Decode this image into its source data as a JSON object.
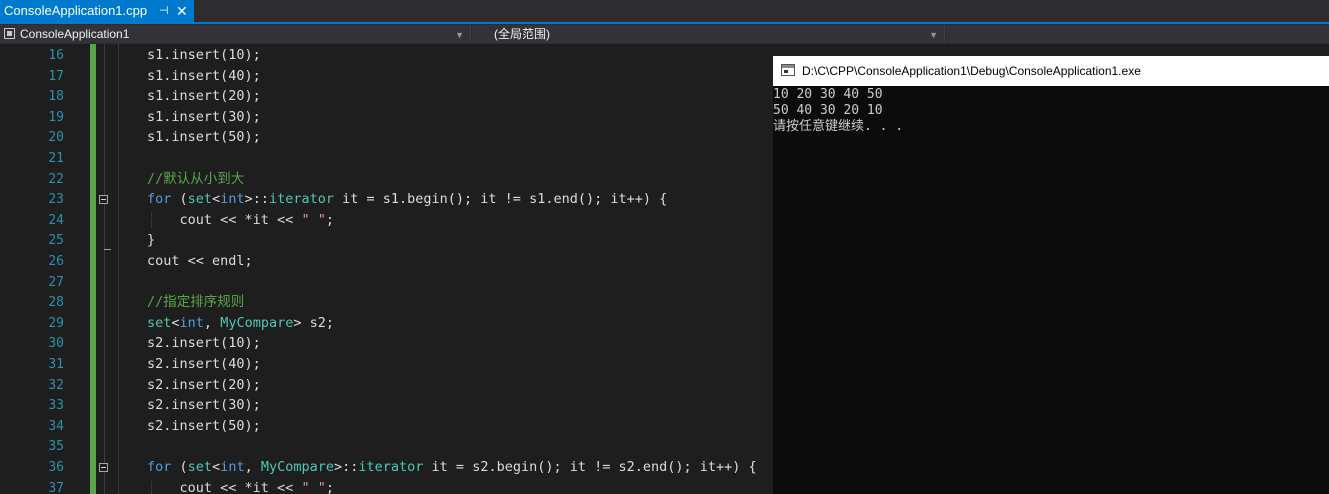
{
  "tab": {
    "title": "ConsoleApplication1.cpp",
    "pin_icon": "pin-icon",
    "close_icon": "close-icon"
  },
  "navbar": {
    "project": "ConsoleApplication1",
    "scope": "(全局范围)",
    "member": ""
  },
  "editor": {
    "lines": [
      {
        "num": "16",
        "code": "s1.insert(10);"
      },
      {
        "num": "17",
        "code": "s1.insert(40);"
      },
      {
        "num": "18",
        "code": "s1.insert(20);"
      },
      {
        "num": "19",
        "code": "s1.insert(30);"
      },
      {
        "num": "20",
        "code": "s1.insert(50);"
      },
      {
        "num": "21",
        "code": ""
      },
      {
        "num": "22",
        "code": "//默认从小到大"
      },
      {
        "num": "23",
        "code": "for (set<int>::iterator it = s1.begin(); it != s1.end(); it++) {"
      },
      {
        "num": "24",
        "code": "    cout << *it << \" \";"
      },
      {
        "num": "25",
        "code": "}"
      },
      {
        "num": "26",
        "code": "cout << endl;"
      },
      {
        "num": "27",
        "code": ""
      },
      {
        "num": "28",
        "code": "//指定排序规则"
      },
      {
        "num": "29",
        "code": "set<int, MyCompare> s2;"
      },
      {
        "num": "30",
        "code": "s2.insert(10);"
      },
      {
        "num": "31",
        "code": "s2.insert(40);"
      },
      {
        "num": "32",
        "code": "s2.insert(20);"
      },
      {
        "num": "33",
        "code": "s2.insert(30);"
      },
      {
        "num": "34",
        "code": "s2.insert(50);"
      },
      {
        "num": "35",
        "code": ""
      },
      {
        "num": "36",
        "code": "for (set<int, MyCompare>::iterator it = s2.begin(); it != s2.end(); it++) {"
      },
      {
        "num": "37",
        "code": "    cout << *it << \" \";"
      }
    ]
  },
  "console": {
    "title": "D:\\C\\CPP\\ConsoleApplication1\\Debug\\ConsoleApplication1.exe",
    "output": [
      "10 20 30 40 50",
      "50 40 30 20 10",
      "请按任意键继续. . ."
    ]
  },
  "colors": {
    "accent": "#007acc",
    "line_number": "#2b91af",
    "keyword": "#569cd6",
    "type": "#4ec9b0",
    "comment": "#57a64a",
    "string": "#d69d85"
  }
}
